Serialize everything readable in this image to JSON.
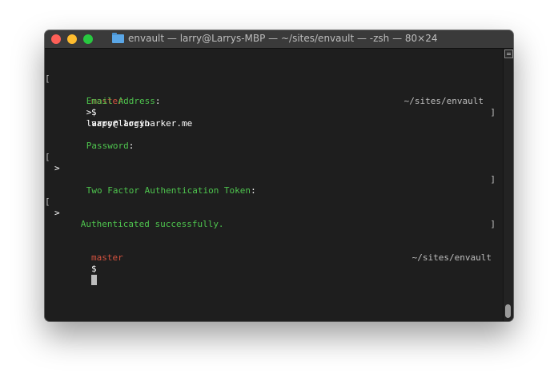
{
  "window": {
    "title": "envault — larry@Larrys-MBP — ~/sites/envault — -zsh — 80×24",
    "folder_icon": "folder-icon",
    "colors": {
      "background": "#1e1e1e",
      "green": "#4ec44e",
      "branch": "#d4523f"
    }
  },
  "terminal": {
    "prompt1": {
      "branch": "master",
      "dollar": "$",
      "command": "vapor login",
      "path": "~/sites/envault"
    },
    "email": {
      "label": "Email Address",
      "colon": ":",
      "caret": ">",
      "value": "larry@larrybarker.me"
    },
    "password": {
      "label": "Password",
      "colon": ":",
      "caret": ">"
    },
    "token": {
      "label": "Two Factor Authentication Token",
      "colon": ":",
      "caret": ">"
    },
    "result": "Authenticated successfully.",
    "prompt2": {
      "branch": "master",
      "dollar": "$",
      "path": "~/sites/envault"
    }
  }
}
